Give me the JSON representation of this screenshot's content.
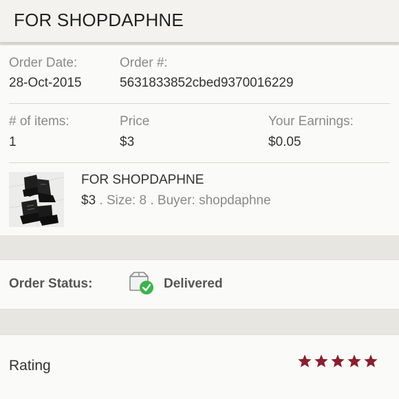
{
  "header": {
    "title": "FOR SHOPDAPHNE"
  },
  "order": {
    "date_label": "Order Date:",
    "date_value": "28-Oct-2015",
    "number_label": "Order #:",
    "number_value": "5631833852cbed9370016229",
    "items_label": "# of items:",
    "items_value": "1",
    "price_label": "Price",
    "price_value": "$3",
    "earnings_label": "Your Earnings:",
    "earnings_value": "$0.05"
  },
  "item": {
    "title": "FOR SHOPDAPHNE",
    "price": "$3",
    "size_text": " . Size: 8 . Buyer: shopdaphne"
  },
  "status": {
    "label": "Order Status:",
    "value": "Delivered",
    "icon": "delivered-box-icon",
    "check_color": "#3bb54a"
  },
  "rating": {
    "label": "Rating",
    "stars": 5,
    "max_stars": 5,
    "star_color": "#8b1e2b"
  }
}
